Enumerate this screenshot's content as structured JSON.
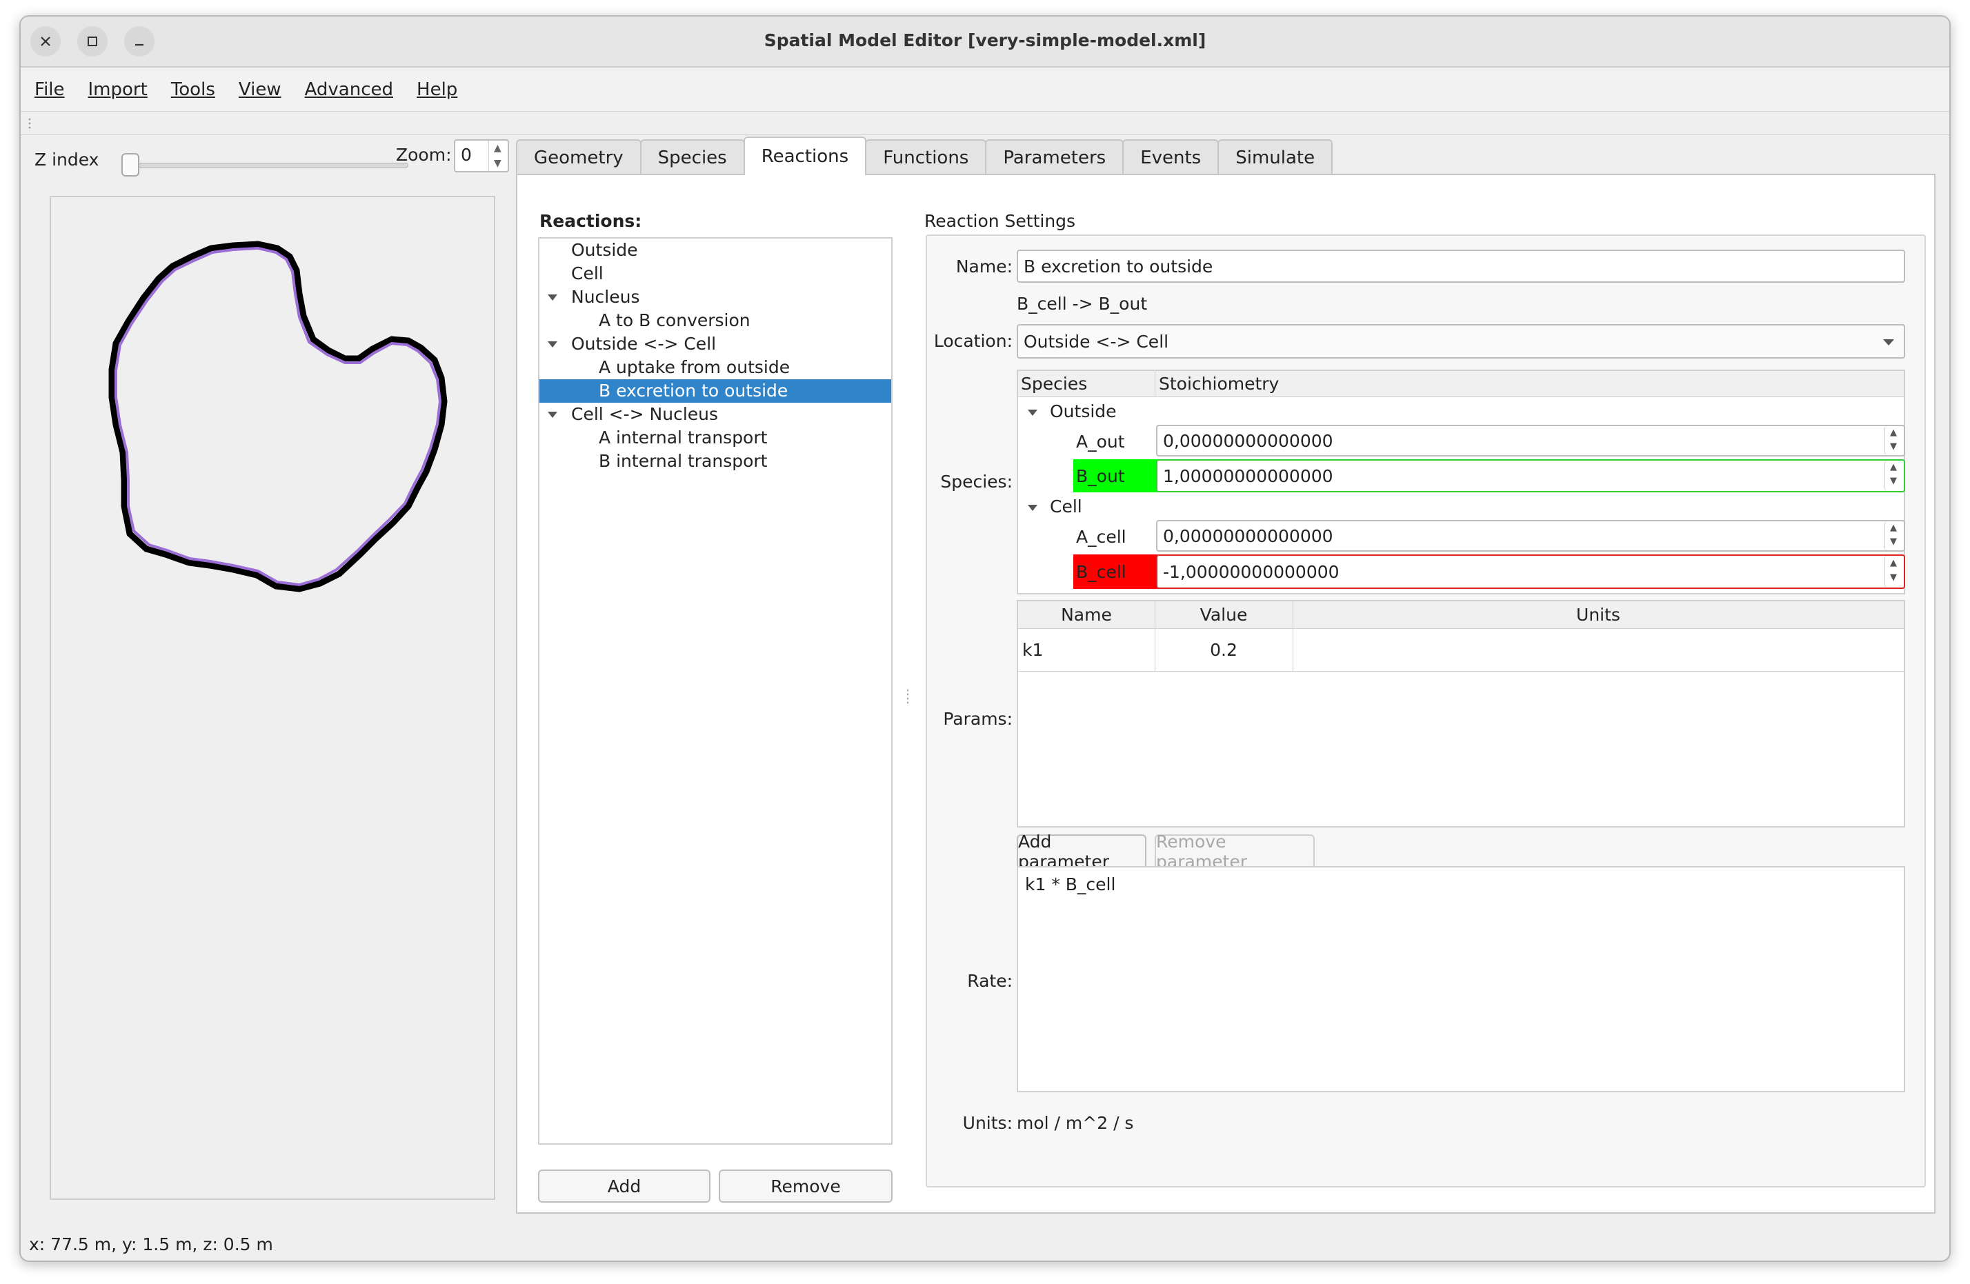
{
  "window": {
    "title": "Spatial Model Editor [very-simple-model.xml]"
  },
  "menu": [
    "File",
    "Import",
    "Tools",
    "View",
    "Advanced",
    "Help"
  ],
  "left_panel": {
    "z_index_label": "Z index",
    "zoom_label": "Zoom:",
    "zoom_value": "0",
    "z_index_value": 0
  },
  "tabs": [
    "Geometry",
    "Species",
    "Reactions",
    "Functions",
    "Parameters",
    "Events",
    "Simulate"
  ],
  "active_tab": "Reactions",
  "reactions": {
    "label": "Reactions:",
    "tree": [
      {
        "label": "Outside",
        "level": 0,
        "expandable": false
      },
      {
        "label": "Cell",
        "level": 0,
        "expandable": false
      },
      {
        "label": "Nucleus",
        "level": 0,
        "expandable": true
      },
      {
        "label": "A to B conversion",
        "level": 1,
        "expandable": false
      },
      {
        "label": "Outside <-> Cell",
        "level": 0,
        "expandable": true
      },
      {
        "label": "A uptake from outside",
        "level": 1,
        "expandable": false
      },
      {
        "label": "B excretion to outside",
        "level": 1,
        "expandable": false,
        "selected": true
      },
      {
        "label": "Cell <-> Nucleus",
        "level": 0,
        "expandable": true
      },
      {
        "label": "A internal transport",
        "level": 1,
        "expandable": false
      },
      {
        "label": "B internal transport",
        "level": 1,
        "expandable": false
      }
    ],
    "add_label": "Add",
    "remove_label": "Remove"
  },
  "settings": {
    "title": "Reaction Settings",
    "name_label": "Name:",
    "name_value": "B excretion to outside",
    "equation": "B_cell -> B_out",
    "location_label": "Location:",
    "location_value": "Outside <-> Cell",
    "species_label": "Species:",
    "species_header": [
      "Species",
      "Stoichiometry"
    ],
    "groups": [
      {
        "name": "Outside",
        "items": [
          {
            "name": "A_out",
            "value": "0,00000000000000",
            "highlight": "none"
          },
          {
            "name": "B_out",
            "value": "1,00000000000000",
            "highlight": "#00ff00"
          }
        ]
      },
      {
        "name": "Cell",
        "items": [
          {
            "name": "A_cell",
            "value": "0,00000000000000",
            "highlight": "none"
          },
          {
            "name": "B_cell",
            "value": "-1,00000000000000",
            "highlight": "#ff0000"
          }
        ]
      }
    ],
    "params_label": "Params:",
    "params_header": [
      "Name",
      "Value",
      "Units"
    ],
    "params": [
      {
        "name": "k1",
        "value": "0.2",
        "units": ""
      }
    ],
    "add_param_label": "Add parameter",
    "remove_param_label": "Remove parameter",
    "rate_label": "Rate:",
    "rate_value": "k1 * B_cell",
    "units_label": "Units:",
    "units_value": "mol / m^2 / s"
  },
  "status": "x: 77.5 m, y: 1.5 m, z: 0.5 m",
  "colors": {
    "selection": "#3084c9",
    "positive_stoich": "#00ff00",
    "negative_stoich": "#ff0000",
    "membrane_outline": "#000000",
    "membrane_inner": "#9b6fd6"
  }
}
